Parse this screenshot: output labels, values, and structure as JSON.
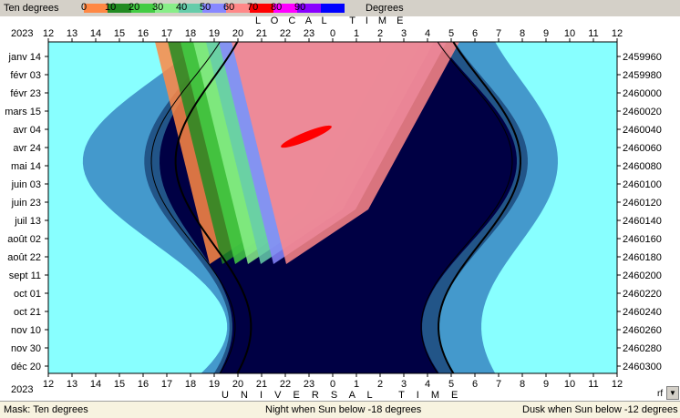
{
  "legend": {
    "title": "Ten degrees",
    "unit": "Degrees",
    "ticks": [
      "0",
      "10",
      "20",
      "30",
      "40",
      "50",
      "60",
      "70",
      "80",
      "90"
    ],
    "colors": [
      "#ff8844",
      "#228b22",
      "#44cc44",
      "#88ee88",
      "#66ccaa",
      "#8888ff",
      "#ff8888",
      "#ff0000",
      "#ff00ff",
      "#8800ff",
      "#0000ff",
      "#ffff88"
    ]
  },
  "header": {
    "top_title": "L O C A L   T I M E",
    "bottom_title": "U N I V E R S A L   T I M E",
    "year_top": "2023",
    "year_bottom": "2023",
    "corner": "rf"
  },
  "chart_data": {
    "type": "heatmap",
    "title": "",
    "x_top_ticks": [
      "12",
      "13",
      "14",
      "15",
      "16",
      "17",
      "18",
      "19",
      "20",
      "21",
      "22",
      "23",
      "0",
      "1",
      "2",
      "3",
      "4",
      "5",
      "6",
      "7",
      "8",
      "9",
      "10",
      "11",
      "12"
    ],
    "x_bottom_ticks": [
      "12",
      "13",
      "14",
      "15",
      "16",
      "17",
      "18",
      "19",
      "20",
      "21",
      "22",
      "23",
      "0",
      "1",
      "2",
      "3",
      "4",
      "5",
      "6",
      "7",
      "8",
      "9",
      "10",
      "11",
      "12"
    ],
    "y_left_ticks": [
      "janv 14",
      "févr 03",
      "févr 23",
      "mars 15",
      "avr 04",
      "avr 24",
      "mai 14",
      "juin 03",
      "juin 23",
      "juil 13",
      "août 02",
      "août 22",
      "sept 11",
      "oct 01",
      "oct 21",
      "nov 10",
      "nov 30",
      "déc 20"
    ],
    "y_right_ticks": [
      "2459960",
      "2459980",
      "2460000",
      "2460020",
      "2460040",
      "2460060",
      "2460080",
      "2460100",
      "2460120",
      "2460140",
      "2460160",
      "2460180",
      "2460200",
      "2460220",
      "2460240",
      "2460260",
      "2460280",
      "2460300"
    ],
    "colors": {
      "day": "#88ffff",
      "civil": "#4499cc",
      "nautical": "#225588",
      "night": "#000044",
      "line": "#000000",
      "spot": "#ff0000"
    }
  },
  "status": {
    "mask": "Mask:  Ten degrees",
    "night": "Night when Sun below -18 degrees",
    "dusk": "Dusk when Sun below -12 degrees"
  }
}
